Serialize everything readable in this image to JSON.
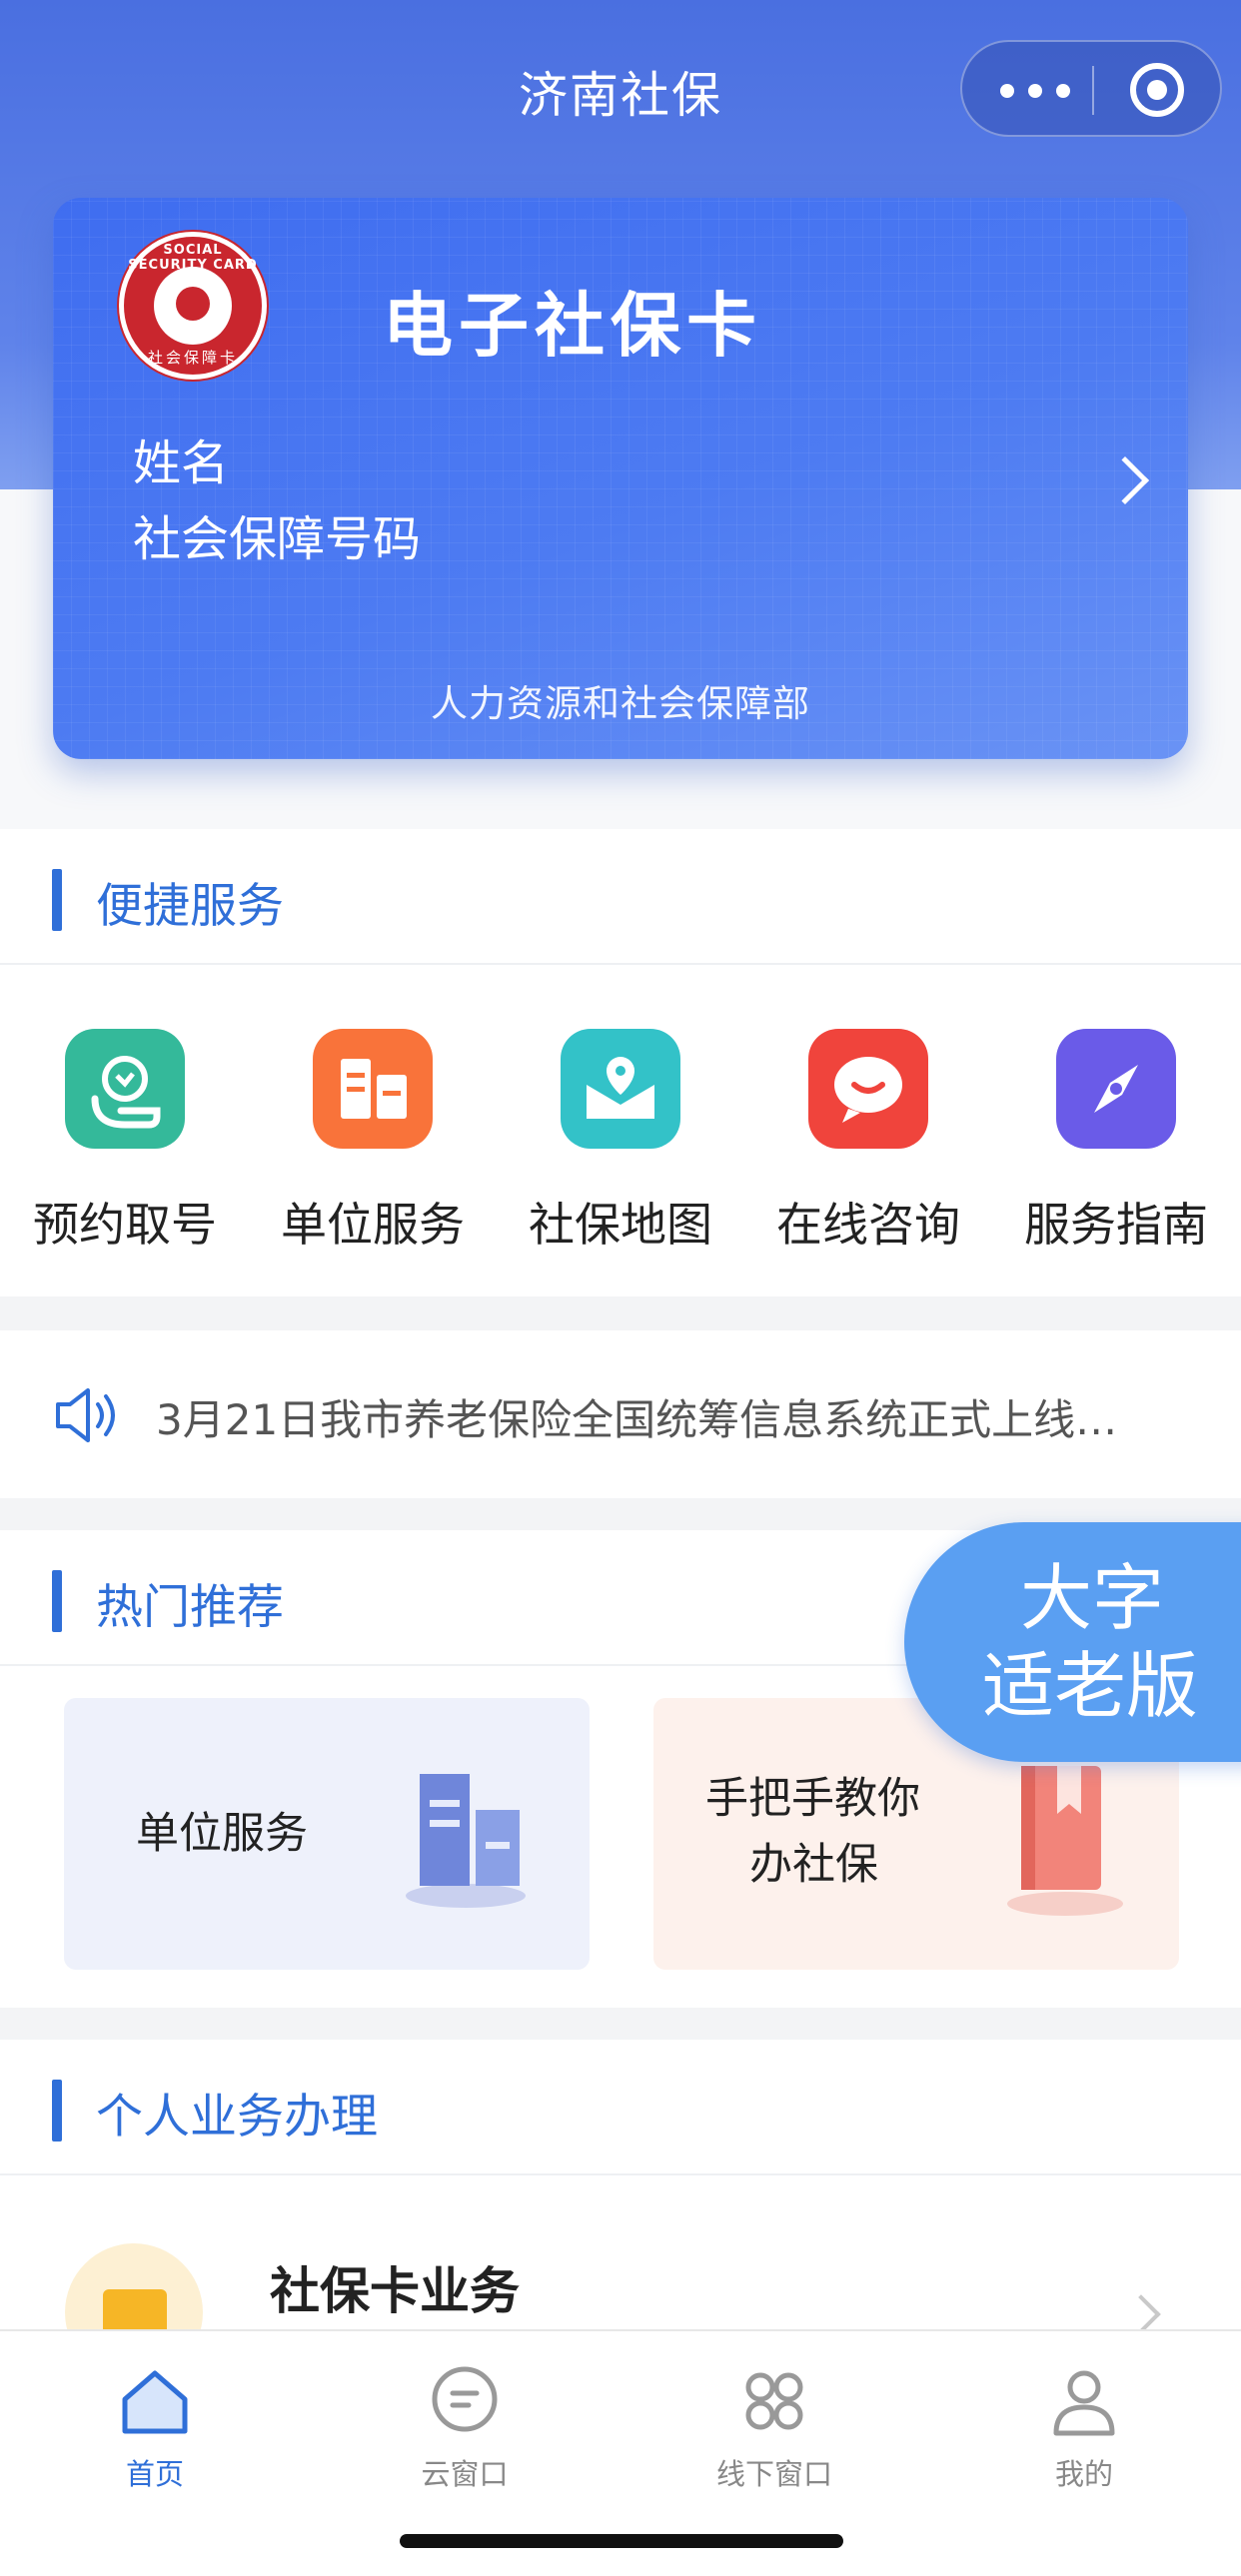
{
  "header": {
    "title": "济南社保"
  },
  "card": {
    "seal_top_text": "SOCIAL SECURITY CARD",
    "seal_bottom_text": "社会保障卡",
    "title": "电子社保卡",
    "name_label": "姓名",
    "ssn_label": "社会保障号码",
    "issuer": "人力资源和社会保障部"
  },
  "quick_services": {
    "title": "便捷服务",
    "items": [
      {
        "label": "预约取号",
        "icon": "hand-heart-icon",
        "color": "#2fb79a"
      },
      {
        "label": "单位服务",
        "icon": "building-icon",
        "color": "#f9733a"
      },
      {
        "label": "社保地图",
        "icon": "map-pin-icon",
        "color": "#2fbfc6"
      },
      {
        "label": "在线咨询",
        "icon": "chat-smile-icon",
        "color": "#f0443c"
      },
      {
        "label": "服务指南",
        "icon": "compass-icon",
        "color": "#6a5be8"
      }
    ]
  },
  "notice": {
    "text": "3月21日我市养老保险全国统筹信息系统正式上线…"
  },
  "hot": {
    "title": "热门推荐",
    "items": [
      {
        "label": "单位服务",
        "bg": "#eef1fb"
      },
      {
        "label_line1": "手把手教你",
        "label_line2": "办社保",
        "bg": "#fdf1ec"
      }
    ]
  },
  "elder_badge": {
    "line1": "大字",
    "line2": "适老版"
  },
  "personal": {
    "title": "个人业务办理",
    "items": [
      {
        "label": "社保卡业务"
      }
    ]
  },
  "tabbar": {
    "items": [
      {
        "label": "首页",
        "active": true
      },
      {
        "label": "云窗口",
        "active": false
      },
      {
        "label": "线下窗口",
        "active": false
      },
      {
        "label": "我的",
        "active": false
      }
    ]
  }
}
